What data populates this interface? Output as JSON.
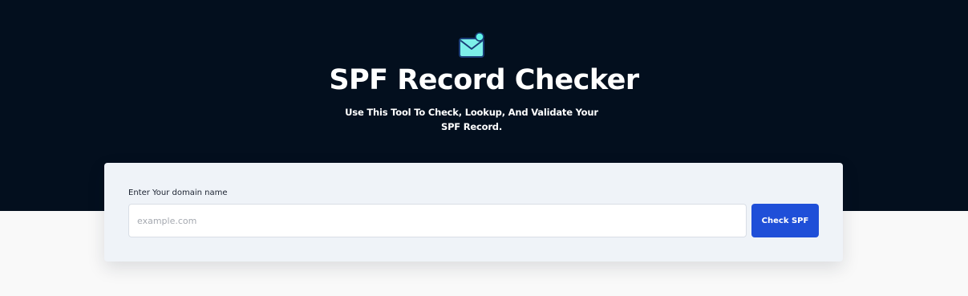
{
  "hero": {
    "icon": "envelope-notification-icon",
    "title": "SPF Record Checker",
    "subtitle": "Use This Tool To Check, Lookup, And Validate Your SPF Record."
  },
  "form": {
    "label": "Enter Your domain name",
    "input_value": "",
    "input_placeholder": "example.com",
    "button_label": "Check SPF"
  },
  "colors": {
    "hero_background": "#030f1e",
    "card_background": "#eff3f8",
    "button_background": "#1f4fd8",
    "icon_accent": "#5ff2e8"
  }
}
